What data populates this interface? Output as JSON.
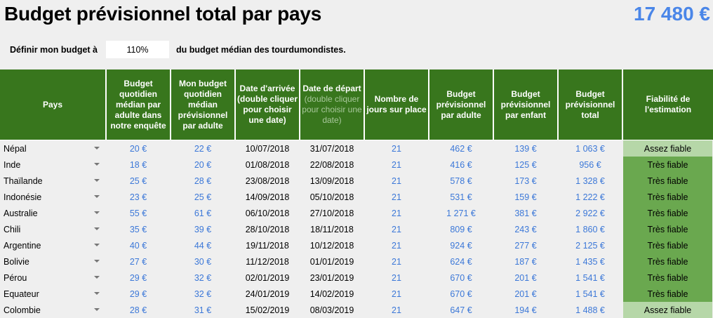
{
  "title": "Budget prévisionnel total par pays",
  "total": "17 480 €",
  "budget_setting": {
    "label_before": "Définir mon budget à",
    "value": "110%",
    "label_after": "du budget médian des tourdumondistes."
  },
  "headers": {
    "pays": "Pays",
    "budget_median": "Budget quotidien médian par adulte dans notre enquête",
    "mon_budget": "Mon budget quotidien médian prévisionnel par adulte",
    "date_arrivee": "Date d'arrivée (double cliquer pour choisir une date)",
    "date_depart_title": "Date de départ",
    "date_depart_hint": "(double cliquer pour choisir une date)",
    "nb_jours": "Nombre de jours sur place",
    "budget_adulte": "Budget prévisionnel par adulte",
    "budget_enfant": "Budget prévisionnel par enfant",
    "budget_total": "Budget prévisionnel total",
    "fiabilite": "Fiabilité de l'estimation"
  },
  "rows": [
    {
      "pays": "Népal",
      "median": "20 €",
      "mon": "22 €",
      "arrivee": "10/07/2018",
      "depart": "31/07/2018",
      "jours": "21",
      "adulte": "462 €",
      "enfant": "139 €",
      "total": "1 063 €",
      "fiabilite": "Assez fiable",
      "level": "assez"
    },
    {
      "pays": "Inde",
      "median": "18 €",
      "mon": "20 €",
      "arrivee": "01/08/2018",
      "depart": "22/08/2018",
      "jours": "21",
      "adulte": "416 €",
      "enfant": "125 €",
      "total": "956 €",
      "fiabilite": "Très fiable",
      "level": "tres"
    },
    {
      "pays": "Thaïlande",
      "median": "25 €",
      "mon": "28 €",
      "arrivee": "23/08/2018",
      "depart": "13/09/2018",
      "jours": "21",
      "adulte": "578 €",
      "enfant": "173 €",
      "total": "1 328 €",
      "fiabilite": "Très fiable",
      "level": "tres"
    },
    {
      "pays": "Indonésie",
      "median": "23 €",
      "mon": "25 €",
      "arrivee": "14/09/2018",
      "depart": "05/10/2018",
      "jours": "21",
      "adulte": "531 €",
      "enfant": "159 €",
      "total": "1 222 €",
      "fiabilite": "Très fiable",
      "level": "tres"
    },
    {
      "pays": "Australie",
      "median": "55 €",
      "mon": "61 €",
      "arrivee": "06/10/2018",
      "depart": "27/10/2018",
      "jours": "21",
      "adulte": "1 271 €",
      "enfant": "381 €",
      "total": "2 922 €",
      "fiabilite": "Très fiable",
      "level": "tres"
    },
    {
      "pays": "Chili",
      "median": "35 €",
      "mon": "39 €",
      "arrivee": "28/10/2018",
      "depart": "18/11/2018",
      "jours": "21",
      "adulte": "809 €",
      "enfant": "243 €",
      "total": "1 860 €",
      "fiabilite": "Très fiable",
      "level": "tres"
    },
    {
      "pays": "Argentine",
      "median": "40 €",
      "mon": "44 €",
      "arrivee": "19/11/2018",
      "depart": "10/12/2018",
      "jours": "21",
      "adulte": "924 €",
      "enfant": "277 €",
      "total": "2 125 €",
      "fiabilite": "Très fiable",
      "level": "tres"
    },
    {
      "pays": "Bolivie",
      "median": "27 €",
      "mon": "30 €",
      "arrivee": "11/12/2018",
      "depart": "01/01/2019",
      "jours": "21",
      "adulte": "624 €",
      "enfant": "187 €",
      "total": "1 435 €",
      "fiabilite": "Très fiable",
      "level": "tres"
    },
    {
      "pays": "Pérou",
      "median": "29 €",
      "mon": "32 €",
      "arrivee": "02/01/2019",
      "depart": "23/01/2019",
      "jours": "21",
      "adulte": "670 €",
      "enfant": "201 €",
      "total": "1 541 €",
      "fiabilite": "Très fiable",
      "level": "tres"
    },
    {
      "pays": "Equateur",
      "median": "29 €",
      "mon": "32 €",
      "arrivee": "24/01/2019",
      "depart": "14/02/2019",
      "jours": "21",
      "adulte": "670 €",
      "enfant": "201 €",
      "total": "1 541 €",
      "fiabilite": "Très fiable",
      "level": "tres"
    },
    {
      "pays": "Colombie",
      "median": "28 €",
      "mon": "31 €",
      "arrivee": "15/02/2019",
      "depart": "08/03/2019",
      "jours": "21",
      "adulte": "647 €",
      "enfant": "194 €",
      "total": "1 488 €",
      "fiabilite": "Assez fiable",
      "level": "assez"
    }
  ],
  "colors": {
    "header_bg": "#38761d",
    "value_blue": "#3c78d8",
    "tres_fiable": "#6aa84f",
    "assez_fiable": "#b6d7a8",
    "total_blue": "#4a86e8"
  }
}
